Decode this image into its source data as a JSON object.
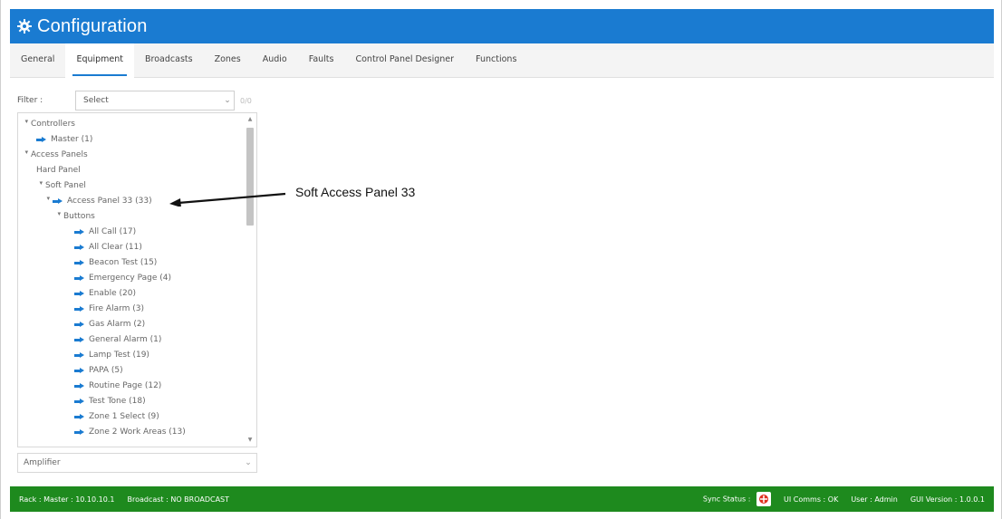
{
  "titlebar": {
    "icon": "gear-icon",
    "title": "Configuration"
  },
  "tabs": [
    {
      "label": "General"
    },
    {
      "label": "Equipment",
      "active": true
    },
    {
      "label": "Broadcasts"
    },
    {
      "label": "Zones"
    },
    {
      "label": "Audio"
    },
    {
      "label": "Faults"
    },
    {
      "label": "Control Panel Designer"
    },
    {
      "label": "Functions"
    }
  ],
  "filter": {
    "label": "Filter :",
    "value": "Select",
    "count": "0/0"
  },
  "tree": [
    {
      "label": "Controllers",
      "level": 0,
      "expanded": true
    },
    {
      "label": "Master (1)",
      "level": 1,
      "arrow": true
    },
    {
      "label": "Access Panels",
      "level": 0,
      "expanded": true
    },
    {
      "label": "Hard Panel",
      "level": 1
    },
    {
      "label": "Soft Panel",
      "level": 1,
      "expanded": true
    },
    {
      "label": "Access Panel 33 (33)",
      "level": 2,
      "expanded": true,
      "arrow": true
    },
    {
      "label": "Buttons",
      "level": 3,
      "expanded": true
    },
    {
      "label": "All Call (17)",
      "level": 4,
      "arrow": true
    },
    {
      "label": "All Clear (11)",
      "level": 4,
      "arrow": true
    },
    {
      "label": "Beacon Test (15)",
      "level": 4,
      "arrow": true
    },
    {
      "label": "Emergency Page (4)",
      "level": 4,
      "arrow": true
    },
    {
      "label": "Enable (20)",
      "level": 4,
      "arrow": true
    },
    {
      "label": "Fire Alarm (3)",
      "level": 4,
      "arrow": true
    },
    {
      "label": "Gas Alarm (2)",
      "level": 4,
      "arrow": true
    },
    {
      "label": "General Alarm (1)",
      "level": 4,
      "arrow": true
    },
    {
      "label": "Lamp Test (19)",
      "level": 4,
      "arrow": true
    },
    {
      "label": "PAPA (5)",
      "level": 4,
      "arrow": true
    },
    {
      "label": "Routine Page (12)",
      "level": 4,
      "arrow": true
    },
    {
      "label": "Test Tone (18)",
      "level": 4,
      "arrow": true
    },
    {
      "label": "Zone 1 Select (9)",
      "level": 4,
      "arrow": true
    },
    {
      "label": "Zone 2 Work Areas (13)",
      "level": 4,
      "arrow": true
    }
  ],
  "amplifier": {
    "value": "Amplifier"
  },
  "annotation": {
    "text": "Soft Access Panel 33"
  },
  "status": {
    "rack": "Rack : Master : 10.10.10.1",
    "broadcast": "Broadcast : NO BROADCAST",
    "sync": "Sync Status :",
    "ui_comms": "UI Comms : OK",
    "user": "User : Admin",
    "gui_version": "GUI Version : 1.0.0.1"
  },
  "colors": {
    "accent": "#1a7bd1",
    "status_bg": "#1e8a1e"
  }
}
